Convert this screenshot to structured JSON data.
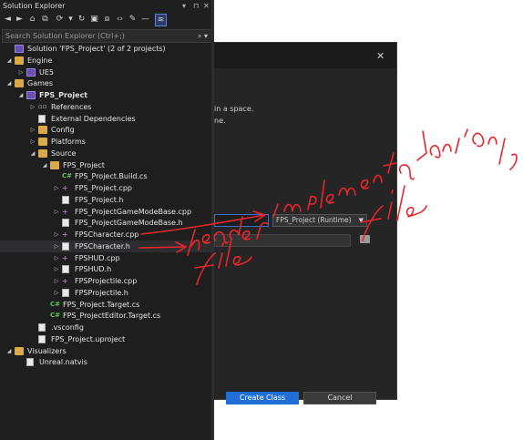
{
  "panel": {
    "title": "Solution Explorer"
  },
  "search": {
    "placeholder": "Search Solution Explorer (Ctrl+;)"
  },
  "tree": [
    {
      "label": "Solution 'FPS_Project' (2 of 2 projects)",
      "icon": "solution-icon",
      "depth": 0,
      "arrow": ""
    },
    {
      "label": "Engine",
      "icon": "folder-icon",
      "depth": 0,
      "arrow": "expanded"
    },
    {
      "label": "UE5",
      "icon": "project-icon",
      "depth": 1,
      "arrow": "collapsed"
    },
    {
      "label": "Games",
      "icon": "folder-icon",
      "depth": 0,
      "arrow": "expanded"
    },
    {
      "label": "FPS_Project",
      "icon": "project-icon",
      "depth": 1,
      "arrow": "expanded",
      "bold": true
    },
    {
      "label": "References",
      "icon": "references-icon",
      "depth": 2,
      "arrow": "collapsed"
    },
    {
      "label": "External Dependencies",
      "icon": "dependencies-icon",
      "depth": 2,
      "arrow": ""
    },
    {
      "label": "Config",
      "icon": "folder-icon",
      "depth": 2,
      "arrow": "collapsed"
    },
    {
      "label": "Platforms",
      "icon": "folder-icon",
      "depth": 2,
      "arrow": "collapsed"
    },
    {
      "label": "Source",
      "icon": "folder-icon",
      "depth": 2,
      "arrow": "expanded"
    },
    {
      "label": "FPS_Project",
      "icon": "folder-icon",
      "depth": 3,
      "arrow": "expanded"
    },
    {
      "label": "FPS_Project.Build.cs",
      "icon": "csharp-file-icon",
      "depth": 4,
      "arrow": ""
    },
    {
      "label": "FPS_Project.cpp",
      "icon": "cpp-file-icon",
      "depth": 4,
      "arrow": "collapsed"
    },
    {
      "label": "FPS_Project.h",
      "icon": "header-file-icon",
      "depth": 4,
      "arrow": ""
    },
    {
      "label": "FPS_ProjectGameModeBase.cpp",
      "icon": "cpp-file-icon",
      "depth": 4,
      "arrow": "collapsed"
    },
    {
      "label": "FPS_ProjectGameModeBase.h",
      "icon": "header-file-icon",
      "depth": 4,
      "arrow": ""
    },
    {
      "label": "FPSCharacter.cpp",
      "icon": "cpp-file-icon",
      "depth": 4,
      "arrow": "collapsed"
    },
    {
      "label": "FPSCharacter.h",
      "icon": "header-file-icon",
      "depth": 4,
      "arrow": "collapsed",
      "selected": true
    },
    {
      "label": "FPSHUD.cpp",
      "icon": "cpp-file-icon",
      "depth": 4,
      "arrow": "collapsed"
    },
    {
      "label": "FPSHUD.h",
      "icon": "header-file-icon",
      "depth": 4,
      "arrow": "collapsed"
    },
    {
      "label": "FPSProjectile.cpp",
      "icon": "cpp-file-icon",
      "depth": 4,
      "arrow": "collapsed"
    },
    {
      "label": "FPSProjectile.h",
      "icon": "header-file-icon",
      "depth": 4,
      "arrow": "collapsed"
    },
    {
      "label": "FPS_Project.Target.cs",
      "icon": "csharp-file-icon",
      "depth": 3,
      "arrow": ""
    },
    {
      "label": "FPS_ProjectEditor.Target.cs",
      "icon": "csharp-file-icon",
      "depth": 3,
      "arrow": ""
    },
    {
      "label": ".vsconfig",
      "icon": "file-icon",
      "depth": 2,
      "arrow": ""
    },
    {
      "label": "FPS_Project.uproject",
      "icon": "file-icon",
      "depth": 2,
      "arrow": ""
    },
    {
      "label": "Visualizers",
      "icon": "folder-icon",
      "depth": 0,
      "arrow": "expanded"
    },
    {
      "label": "Unreal.natvis",
      "icon": "file-icon",
      "depth": 1,
      "arrow": ""
    }
  ],
  "dialog": {
    "text_line1": "in a space.",
    "text_line2": "ne.",
    "module_select": "FPS_Project (Runtime)",
    "create_label": "Create Class",
    "cancel_label": "Cancel",
    "close_icon": "close-icon"
  },
  "annotations": {
    "implementation": "implementation file",
    "header": "header file",
    "ink_color": "#e8262c"
  }
}
